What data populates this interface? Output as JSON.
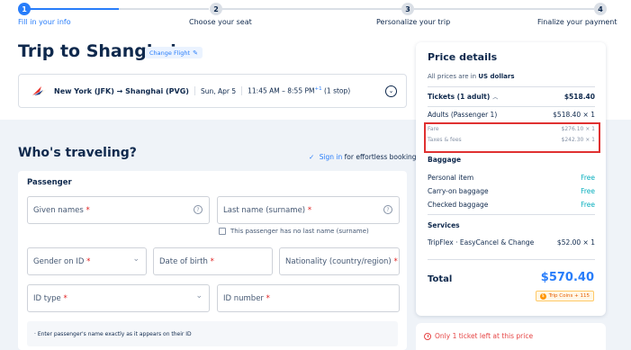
{
  "stepper": {
    "steps": [
      {
        "num": "1",
        "label": "Fill in your info"
      },
      {
        "num": "2",
        "label": "Choose your seat"
      },
      {
        "num": "3",
        "label": "Personalize your trip"
      },
      {
        "num": "4",
        "label": "Finalize your payment"
      }
    ],
    "accent_color": "#287dfa"
  },
  "header": {
    "title": "Trip to Shanghai",
    "change_flight": "Change Flight",
    "change_icon": "edit-icon"
  },
  "flight": {
    "route": "New York (JFK) → Shanghai (PVG)",
    "date": "Sun, Apr 5",
    "time": "11:45 AM – 8:55 PM",
    "day_offset": "+1",
    "stops": "(1 stop)"
  },
  "travelers": {
    "title": "Who's traveling?",
    "sign_in_link": "Sign in",
    "sign_in_rest": "for effortless booking",
    "section_label": "Passenger",
    "given_names": "Given names",
    "last_name": "Last name (surname)",
    "no_last_name": "This passenger has no last name (surname)",
    "gender": "Gender on ID",
    "dob": "Date of birth",
    "nationality": "Nationality (country/region)",
    "id_type": "ID type",
    "id_number": "ID number",
    "req_mark": "*",
    "note": "·  Enter passenger's name exactly as it appears on their ID"
  },
  "price": {
    "title": "Price details",
    "sub_prefix": "All prices are in",
    "currency": "US dollars",
    "tickets_label": "Tickets (1 adult)",
    "tickets_total": "$518.40",
    "adults_label": "Adults (Passenger 1)",
    "adults_value": "$518.40 × 1",
    "fare_label": "Fare",
    "fare_value": "$276.10 × 1",
    "taxes_label": "Taxes & fees",
    "taxes_value": "$242.30 × 1",
    "baggage_title": "Baggage",
    "personal_item": "Personal item",
    "carry_on": "Carry-on baggage",
    "checked": "Checked baggage",
    "free": "Free",
    "services_title": "Services",
    "service_name": "TripFlex · EasyCancel & Change",
    "service_value": "$52.00 × 1",
    "total_label": "Total",
    "total_value": "$570.40",
    "coins": "Trip Coins + 115",
    "total_color": "#287dfa"
  },
  "alert": {
    "text": "Only 1 ticket left at this price",
    "color": "#e64545"
  }
}
